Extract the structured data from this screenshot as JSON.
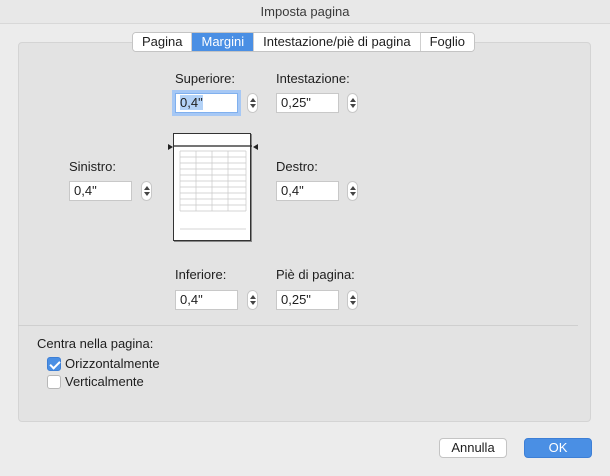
{
  "window": {
    "title": "Imposta pagina"
  },
  "tabs": [
    {
      "label": "Pagina",
      "active": false
    },
    {
      "label": "Margini",
      "active": true
    },
    {
      "label": "Intestazione/piè di pagina",
      "active": false
    },
    {
      "label": "Foglio",
      "active": false
    }
  ],
  "margins": {
    "top": {
      "label": "Superiore:",
      "value": "0,4\""
    },
    "header": {
      "label": "Intestazione:",
      "value": "0,25\""
    },
    "left": {
      "label": "Sinistro:",
      "value": "0,4\""
    },
    "right": {
      "label": "Destro:",
      "value": "0,4\""
    },
    "bottom": {
      "label": "Inferiore:",
      "value": "0,4\""
    },
    "footer": {
      "label": "Piè di pagina:",
      "value": "0,25\""
    }
  },
  "center": {
    "heading": "Centra nella pagina:",
    "horizontal": {
      "label": "Orizzontalmente",
      "checked": true
    },
    "vertical": {
      "label": "Verticalmente",
      "checked": false
    }
  },
  "buttons": {
    "cancel": "Annulla",
    "ok": "OK"
  },
  "colors": {
    "accent": "#4a8fe4",
    "panel": "#e3e3e3",
    "window": "#ececec"
  }
}
